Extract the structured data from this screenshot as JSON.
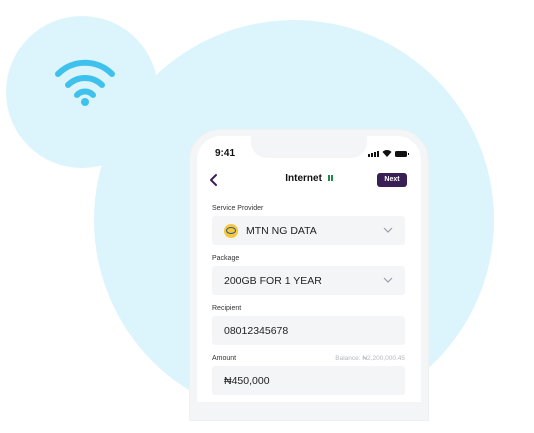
{
  "status_bar": {
    "time": "9:41"
  },
  "header": {
    "title": "Internet",
    "next_label": "Next"
  },
  "fields": {
    "service_provider": {
      "label": "Service Provider",
      "value": "MTN NG DATA"
    },
    "package": {
      "label": "Package",
      "value": "200GB FOR 1 YEAR"
    },
    "recipient": {
      "label": "Recipient",
      "value": "08012345678"
    },
    "amount": {
      "label": "Amount",
      "value": "₦450,000",
      "balance": "Balance: ₦2,200,000.45"
    }
  },
  "icons": {
    "wifi": "wifi-icon",
    "back": "chevron-left-icon",
    "dropdown": "chevron-down-icon",
    "provider_logo": "mtn-logo"
  },
  "colors": {
    "background_blob": "#dcf4fb",
    "wifi_icon": "#3ec1ec",
    "accent": "#3a1f55",
    "field_bg": "#f4f5f7",
    "flag_green": "#1c8a4a"
  }
}
